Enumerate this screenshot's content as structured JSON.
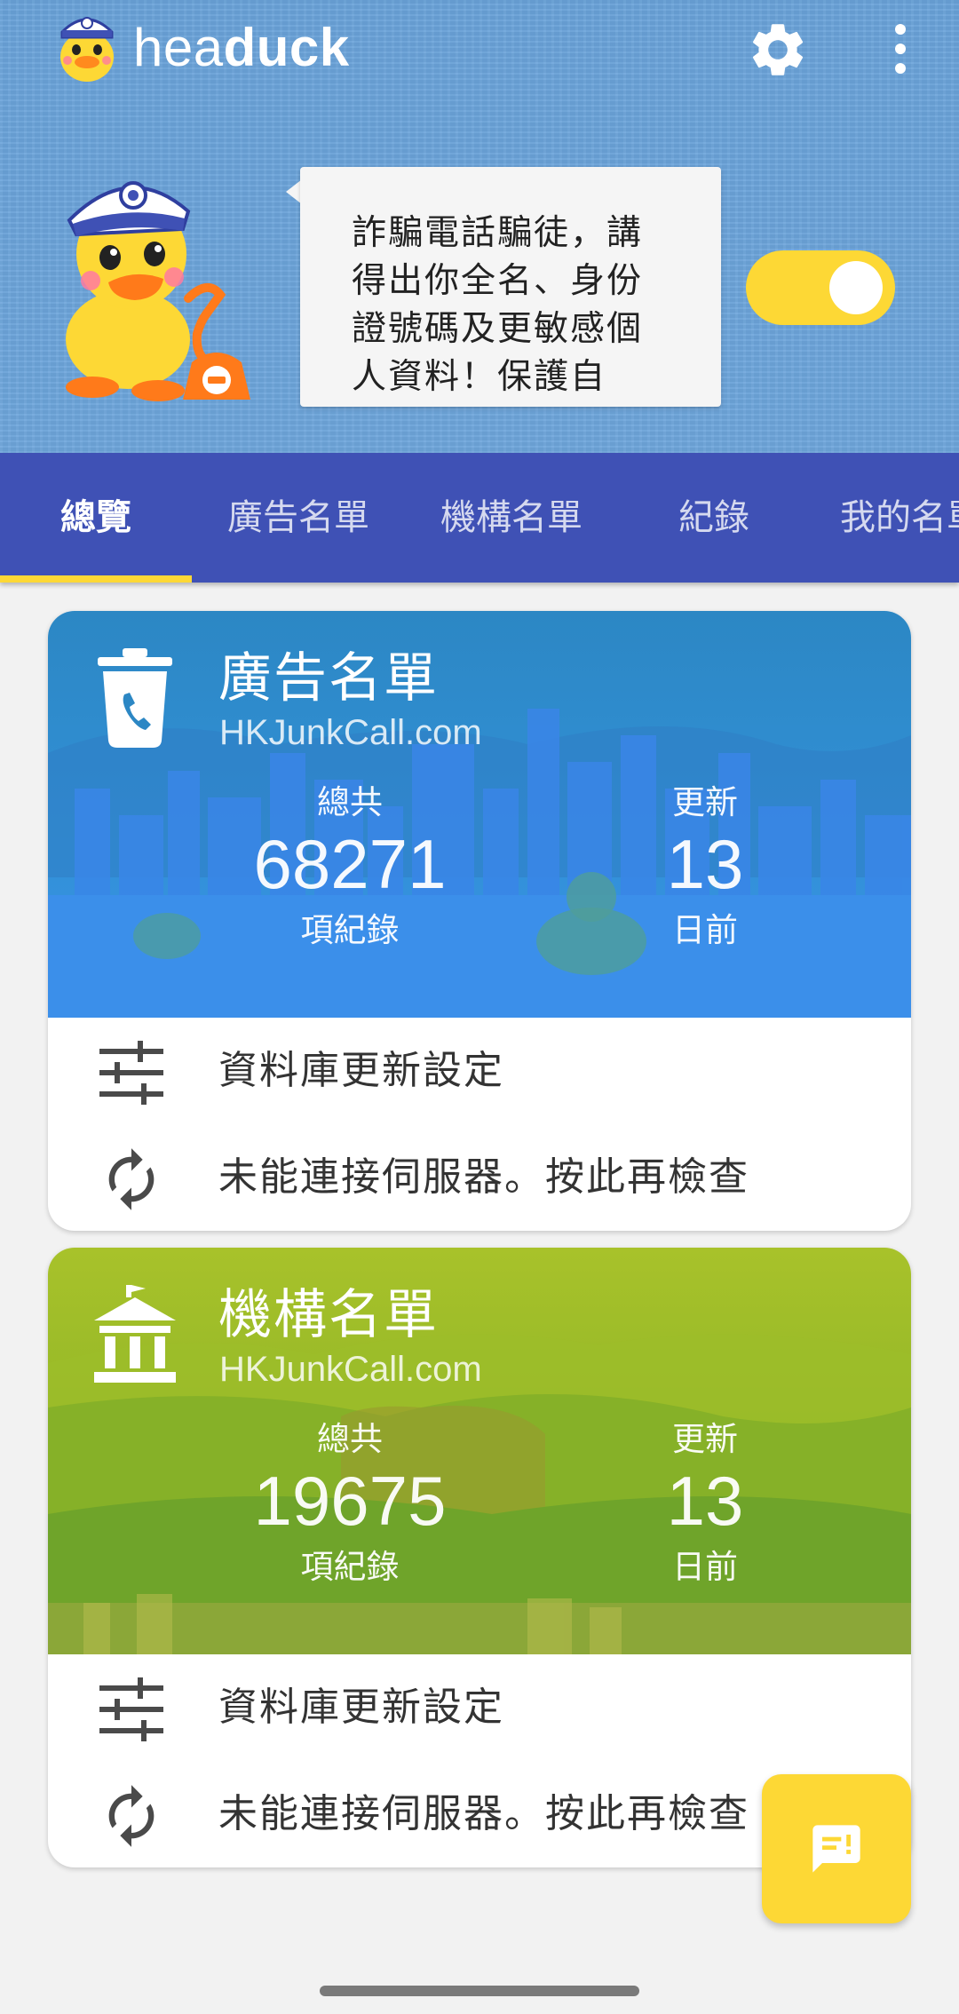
{
  "app": {
    "title_light": "hea",
    "title_bold": "duck",
    "logo_icon": "duck-police-logo-icon",
    "settings_icon": "gear-icon",
    "more_icon": "more-vert-icon"
  },
  "hero": {
    "mascot_icon": "duck-police-mascot-icon",
    "bubble_lines": [
      "詐騙電話騙徒，講",
      "得出你全名、身份",
      "證號碼及更敏感個",
      "人資料！保護自"
    ],
    "protection_toggle_on": true
  },
  "tabs": [
    {
      "label": "總覽",
      "active": true
    },
    {
      "label": "廣告名單",
      "active": false
    },
    {
      "label": "機構名單",
      "active": false
    },
    {
      "label": "紀錄",
      "active": false
    },
    {
      "label": "我的名單",
      "active": false
    }
  ],
  "cards": [
    {
      "icon": "trash-phone-icon",
      "title": "廣告名單",
      "source": "HKJunkCall.com",
      "total_label": "總共",
      "total_value": "68271",
      "total_unit": "項紀錄",
      "update_label": "更新",
      "update_value": "13",
      "update_unit": "日前",
      "settings_label": "資料庫更新設定",
      "settings_icon": "sliders-icon",
      "status_label": "未能連接伺服器。按此再檢查",
      "status_icon": "refresh-icon"
    },
    {
      "icon": "institution-icon",
      "title": "機構名單",
      "source": "HKJunkCall.com",
      "total_label": "總共",
      "total_value": "19675",
      "total_unit": "項紀錄",
      "update_label": "更新",
      "update_value": "13",
      "update_unit": "日前",
      "settings_label": "資料庫更新設定",
      "settings_icon": "sliders-icon",
      "status_label": "未能連接伺服器。按此再檢查",
      "status_icon": "refresh-icon"
    }
  ],
  "fab": {
    "icon": "feedback-icon"
  },
  "colors": {
    "header_bg": "#6ea6dc",
    "tabbar_bg": "#3f51b5",
    "accent_yellow": "#fdd835",
    "card1_banner": "#3291d8",
    "card2_banner": "#8fb527"
  }
}
